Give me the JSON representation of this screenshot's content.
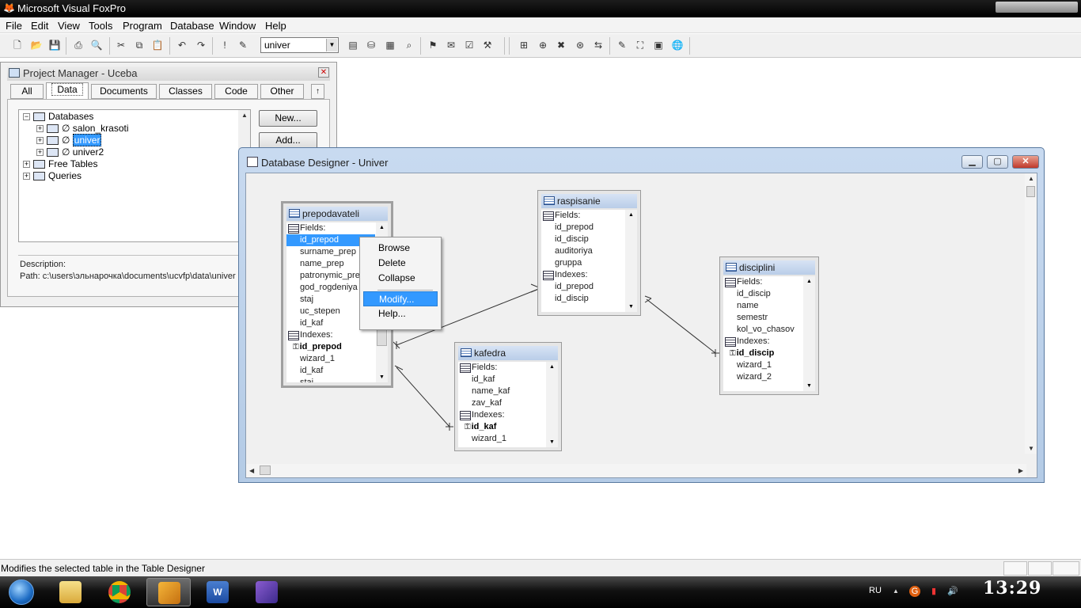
{
  "app": {
    "title": "Microsoft Visual FoxPro"
  },
  "menu": [
    "File",
    "Edit",
    "View",
    "Tools",
    "Program",
    "Database",
    "Window",
    "Help"
  ],
  "toolbar": {
    "combo_value": "univer"
  },
  "project_manager": {
    "title": "Project Manager - Uceba",
    "tabs": [
      "All",
      "Data",
      "Documents",
      "Classes",
      "Code",
      "Other"
    ],
    "active_tab": "Data",
    "tree": {
      "databases": "Databases",
      "db_items": [
        "salon_krasoti",
        "univer",
        "univer2"
      ],
      "selected_db": "univer",
      "no_symbol": "∅",
      "free_tables": "Free Tables",
      "queries": "Queries"
    },
    "buttons": {
      "new": "New...",
      "add": "Add..."
    },
    "description_label": "Description:",
    "path_label": "Path: c:\\users\\эльнарочка\\documents\\ucvfp\\data\\univer"
  },
  "designer": {
    "title": "Database Designer - Univer",
    "tables": {
      "prepodavateli": {
        "name": "prepodavateli",
        "fields_label": "Fields:",
        "fields": [
          "id_prepod",
          "surname_prep",
          "name_prep",
          "patronymic_prep",
          "god_rogdeniya",
          "staj",
          "uc_stepen",
          "id_kaf"
        ],
        "indexes_label": "Indexes:",
        "key_index": "id_prepod",
        "indexes": [
          "wizard_1",
          "id_kaf",
          "staj"
        ]
      },
      "raspisanie": {
        "name": "raspisanie",
        "fields_label": "Fields:",
        "fields": [
          "id_prepod",
          "id_discip",
          "auditoriya",
          "gruppa"
        ],
        "indexes_label": "Indexes:",
        "indexes": [
          "id_prepod",
          "id_discip"
        ]
      },
      "kafedra": {
        "name": "kafedra",
        "fields_label": "Fields:",
        "fields": [
          "id_kaf",
          "name_kaf",
          "zav_kaf"
        ],
        "indexes_label": "Indexes:",
        "key_index": "id_kaf",
        "indexes": [
          "wizard_1"
        ]
      },
      "disciplini": {
        "name": "disciplini",
        "fields_label": "Fields:",
        "fields": [
          "id_discip",
          "name",
          "semestr",
          "kol_vo_chasov"
        ],
        "indexes_label": "Indexes:",
        "key_index": "id_discip",
        "indexes": [
          "wizard_1",
          "wizard_2"
        ]
      }
    },
    "context_menu": [
      "Browse",
      "Delete",
      "Collapse",
      "Modify...",
      "Help..."
    ],
    "context_menu_highlighted": "Modify..."
  },
  "status": {
    "text": "Modifies the selected table in the Table Designer"
  },
  "taskbar": {
    "items": [
      "explorer-icon",
      "chrome-icon",
      "foxpro-icon",
      "word-icon",
      "editor-icon"
    ],
    "lang": "RU",
    "clock": "13:29"
  }
}
